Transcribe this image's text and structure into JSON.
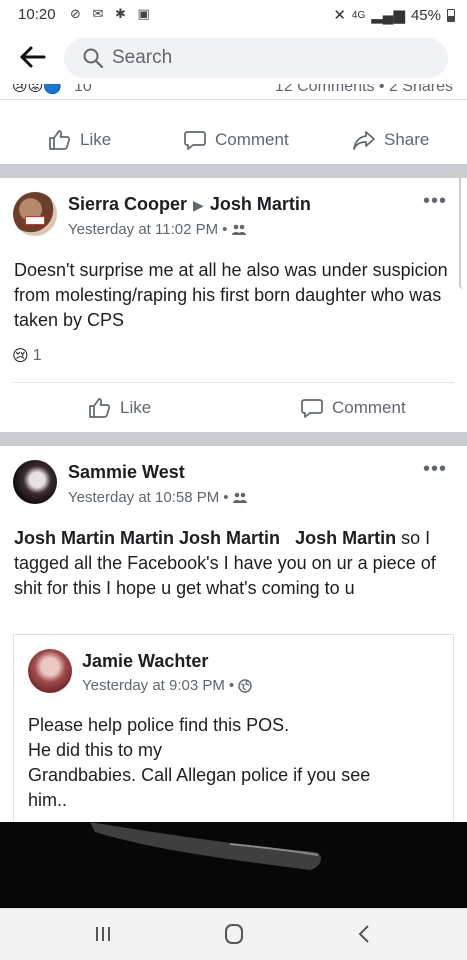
{
  "status_bar": {
    "time": "10:20",
    "battery": "45%",
    "network": "4G"
  },
  "top_bar": {
    "search_placeholder": "Search"
  },
  "prev_post": {
    "reaction_count": "10",
    "comments_shares": "12 Comments • 2 Shares",
    "actions": {
      "like": "Like",
      "comment": "Comment",
      "share": "Share"
    }
  },
  "post1": {
    "author": "Sierra Cooper",
    "target": "Josh Martin",
    "time": "Yesterday at 11:02 PM",
    "separator": "•",
    "text": "Doesn't surprise me at all he also was under suspicion from molesting/raping his first born daughter who was taken by CPS",
    "reaction_count": "1",
    "actions": {
      "like": "Like",
      "comment": "Comment"
    }
  },
  "post2": {
    "author": "Sammie West",
    "time": "Yesterday at 10:58 PM",
    "separator": "•",
    "tags": [
      "Josh Martin",
      "Martin Josh Martin",
      "Josh Martin"
    ],
    "text": "so I tagged all the Facebook's I have you on ur a piece of shit for this I hope u get what's coming to u",
    "shared": {
      "author": "Jamie Wachter",
      "time": "Yesterday at 9:03 PM",
      "separator": "•",
      "lines": [
        "Please help police find this POS.",
        "He did this to my",
        "Grandbabies.  Call Allegan police if you see",
        "him.."
      ]
    }
  },
  "colors": {
    "text": "#1c1e21",
    "secondary": "#606770",
    "divider": "#c9ccd1",
    "search_bg": "#f0f2f5"
  }
}
